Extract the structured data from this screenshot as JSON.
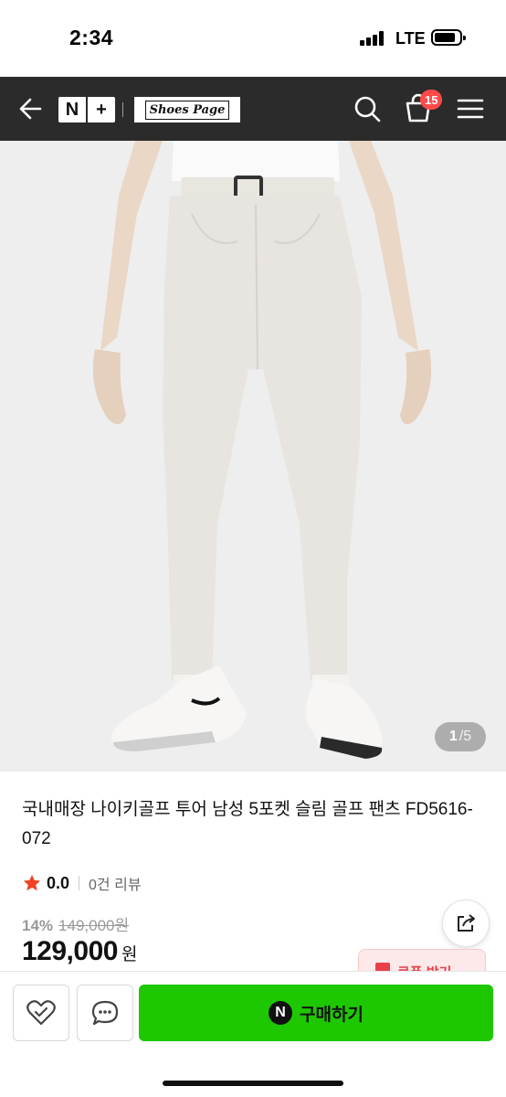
{
  "status_bar": {
    "time": "2:34",
    "network": "LTE"
  },
  "header": {
    "logo_left": "N",
    "logo_right": "+",
    "brand": "Shoes Page",
    "cart_count": "15",
    "icons": {
      "back": "arrow-left-icon",
      "search": "search-icon",
      "cart": "cart-icon",
      "menu": "hamburger-menu-icon"
    }
  },
  "gallery": {
    "current": "1",
    "total": "/5"
  },
  "product": {
    "title": "국내매장 나이키골프 투어 남성 5포켓 슬림 골프 팬츠 FD5616-072",
    "rating": "0.0",
    "review_count": "0건 리뷰",
    "discount_rate": "14%",
    "original_price": "149,000원",
    "price": "129,000",
    "price_unit": "원"
  },
  "coupon": {
    "label": "쿠폰 받기"
  },
  "bottom_bar": {
    "buy_label": "구매하기",
    "npay_mark": "N"
  },
  "colors": {
    "header_bg": "#2b2b2b",
    "badge": "#ff4a4a",
    "buy_green": "#1ec800",
    "star": "#f04323",
    "coupon": "#e8404a"
  }
}
